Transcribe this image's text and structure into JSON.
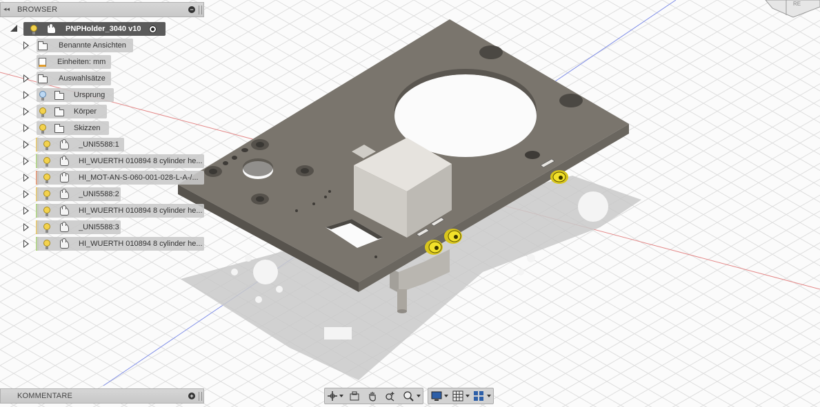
{
  "browser": {
    "title": "BROWSER",
    "root": {
      "label": "PNPHolder_3040 v10"
    },
    "items": [
      {
        "label": "Benannte Ansichten",
        "kind": "folder"
      },
      {
        "label": "Einheiten: mm",
        "kind": "units"
      },
      {
        "label": "Auswahlsätze",
        "kind": "folder"
      },
      {
        "label": "Ursprung",
        "kind": "folder",
        "bulb": "blue"
      },
      {
        "label": "Körper",
        "kind": "folder",
        "bulb": "yellow"
      },
      {
        "label": "Skizzen",
        "kind": "folder",
        "bulb": "yellow"
      },
      {
        "label": "_UNI5588:1",
        "kind": "component",
        "bulb": "yellow",
        "stripe": "#f0c850"
      },
      {
        "label": "HI_WUERTH 010894 8 cylinder he...",
        "kind": "component",
        "bulb": "yellow",
        "stripe": "#a8d86a"
      },
      {
        "label": "HI_MOT-AN-S-060-001-028-L-A-/...",
        "kind": "component-flat",
        "bulb": "yellow",
        "stripe": "#ee8a5a"
      },
      {
        "label": "_UNI5588:2",
        "kind": "component",
        "bulb": "yellow",
        "stripe": "#f0c850"
      },
      {
        "label": "HI_WUERTH 010894 8 cylinder he...",
        "kind": "component",
        "bulb": "yellow",
        "stripe": "#a8d86a"
      },
      {
        "label": "_UNI5588:3",
        "kind": "component",
        "bulb": "yellow",
        "stripe": "#f0c850"
      },
      {
        "label": "HI_WUERTH 010894 8 cylinder he...",
        "kind": "component",
        "bulb": "yellow",
        "stripe": "#a8d86a"
      }
    ]
  },
  "comments": {
    "title": "KOMMENTARE"
  },
  "toolbar": {
    "icons": [
      "orbit-icon",
      "look-at-icon",
      "pan-icon",
      "zoom-icon",
      "zoom-window-icon",
      "display-settings-icon",
      "grid-icon",
      "viewports-icon"
    ]
  },
  "colors": {
    "plate": "#6f6a62",
    "plate_dark": "#55514b",
    "motor": "#d8d5cf",
    "screw": "#f2e12a",
    "grid": "#dcdcdc"
  },
  "viewcube": {
    "label": "RE"
  }
}
